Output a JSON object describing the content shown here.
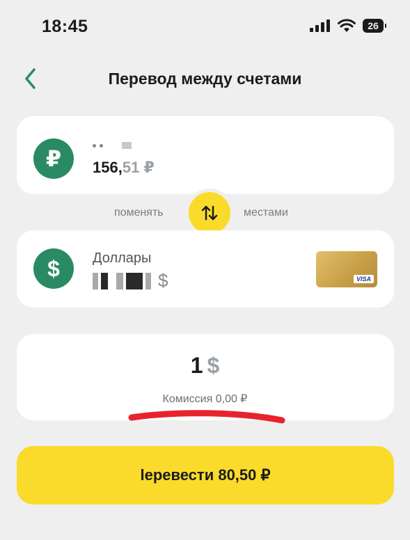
{
  "status_bar": {
    "time": "18:45",
    "battery": "26"
  },
  "header": {
    "title": "Перевод между счетами"
  },
  "from_account": {
    "currency_symbol": "₽",
    "balance_main": "156,",
    "balance_cents": "51",
    "balance_currency": "₽"
  },
  "swap": {
    "left_label": "поменять",
    "right_label": "местами"
  },
  "to_account": {
    "currency_symbol": "$",
    "name": "Доллары",
    "balance_currency": "$",
    "card_brand": "VISA"
  },
  "amount": {
    "value": "1",
    "currency": "$",
    "fee": "Комиссия 0,00 ₽"
  },
  "submit": {
    "label": "lеревести 80,50 ₽"
  },
  "colors": {
    "accent_green": "#2a8a64",
    "accent_yellow": "#fadb2b",
    "underline_red": "#e8232e"
  }
}
